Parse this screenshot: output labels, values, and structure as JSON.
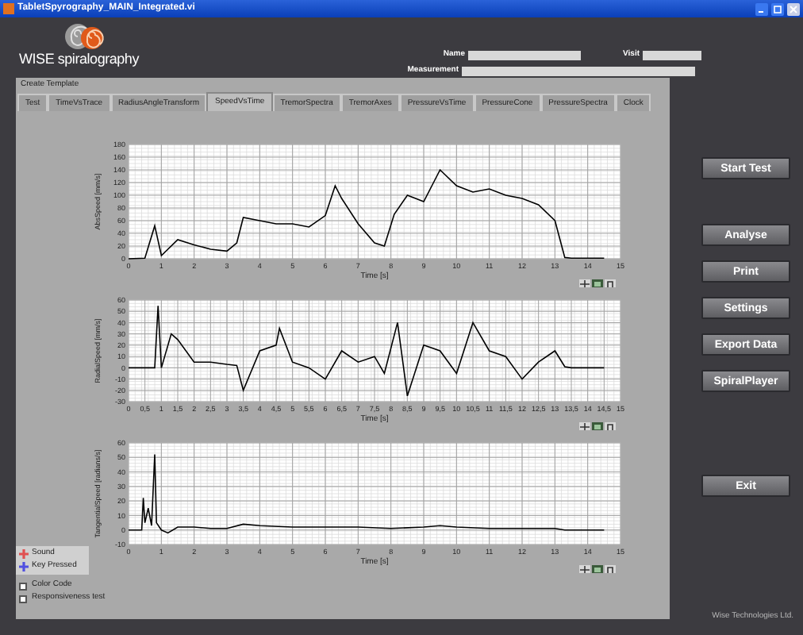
{
  "window": {
    "title": "TabletSpyrography_MAIN_Integrated.vi"
  },
  "logo_text": "WISE spiralography",
  "fields": [
    {
      "label": "Name"
    },
    {
      "label": "Visit"
    },
    {
      "label": "Measurement"
    }
  ],
  "template_label": "Create Template",
  "tabs": [
    {
      "label": "Test",
      "selected": false
    },
    {
      "label": "TimeVsTrace",
      "selected": false
    },
    {
      "label": "RadiusAngleTransform",
      "selected": false
    },
    {
      "label": "SpeedVsTime",
      "selected": true
    },
    {
      "label": "TremorSpectra",
      "selected": false
    },
    {
      "label": "TremorAxes",
      "selected": false
    },
    {
      "label": "PressureVsTime",
      "selected": false
    },
    {
      "label": "PressureCone",
      "selected": false
    },
    {
      "label": "PressureSpectra",
      "selected": false
    },
    {
      "label": "Clock",
      "selected": false
    }
  ],
  "charts": [
    {
      "chart_data": {
        "type": "line",
        "xlabel": "Time [s]",
        "ylabel": "AbsSpeed [mm/s]",
        "xlim": [
          0,
          15
        ],
        "ylim": [
          0,
          180
        ],
        "x": [
          0,
          0.5,
          0.8,
          1,
          1.5,
          2,
          2.5,
          3,
          3.3,
          3.5,
          4,
          4.5,
          5,
          5.5,
          6,
          6.3,
          6.5,
          7,
          7.5,
          7.8,
          8.1,
          8.5,
          9,
          9.5,
          10,
          10.5,
          11,
          11.5,
          12,
          12.5,
          13,
          13.3,
          13.5,
          14,
          14.5
        ],
        "values": [
          0,
          1,
          52,
          5,
          30,
          22,
          15,
          12,
          25,
          65,
          60,
          55,
          55,
          50,
          68,
          115,
          95,
          55,
          25,
          20,
          70,
          100,
          90,
          140,
          115,
          105,
          110,
          100,
          95,
          85,
          60,
          2,
          1,
          1,
          1
        ],
        "grid": true,
        "xticks": [
          0,
          1,
          2,
          3,
          4,
          5,
          6,
          7,
          8,
          9,
          10,
          11,
          12,
          13,
          14,
          15
        ],
        "yticks": [
          0,
          20,
          40,
          60,
          80,
          100,
          120,
          140,
          160,
          180
        ]
      }
    },
    {
      "chart_data": {
        "type": "line",
        "xlabel": "Time [s]",
        "ylabel": "RadialSpeed [mm/s]",
        "xlim": [
          0,
          15
        ],
        "ylim": [
          -30,
          60
        ],
        "x": [
          0,
          0.5,
          0.8,
          0.9,
          1,
          1.3,
          1.5,
          2,
          2.5,
          3,
          3.3,
          3.5,
          4,
          4.5,
          4.6,
          5,
          5.5,
          6,
          6.5,
          7,
          7.5,
          7.8,
          8.2,
          8.5,
          9,
          9.5,
          10,
          10.5,
          11,
          11.5,
          12,
          12.5,
          13,
          13.3,
          13.5,
          14,
          14.5
        ],
        "values": [
          0,
          0,
          0,
          55,
          0,
          30,
          25,
          5,
          5,
          3,
          2,
          -20,
          15,
          20,
          35,
          5,
          0,
          -10,
          15,
          5,
          10,
          -5,
          40,
          -25,
          20,
          15,
          -5,
          40,
          15,
          10,
          -10,
          5,
          15,
          1,
          0,
          0,
          0
        ],
        "grid": true,
        "xticks": [
          0,
          {
            "value": 0.5,
            "label": "0,5"
          },
          1,
          {
            "value": 1.5,
            "label": "1,5"
          },
          2,
          {
            "value": 2.5,
            "label": "2,5"
          },
          3,
          {
            "value": 3.5,
            "label": "3,5"
          },
          4,
          {
            "value": 4.5,
            "label": "4,5"
          },
          5,
          {
            "value": 5.5,
            "label": "5,5"
          },
          6,
          {
            "value": 6.5,
            "label": "6,5"
          },
          7,
          {
            "value": 7.5,
            "label": "7,5"
          },
          8,
          {
            "value": 8.5,
            "label": "8,5"
          },
          9,
          {
            "value": 9.5,
            "label": "9,5"
          },
          10,
          {
            "value": 10.5,
            "label": "10,5"
          },
          11,
          {
            "value": 11.5,
            "label": "11,5"
          },
          12,
          {
            "value": 12.5,
            "label": "12,5"
          },
          13,
          {
            "value": 13.5,
            "label": "13,5"
          },
          14,
          {
            "value": 14.5,
            "label": "14,5"
          },
          15
        ],
        "yticks": [
          -30,
          -20,
          -10,
          0,
          10,
          20,
          30,
          40,
          50,
          60
        ]
      }
    },
    {
      "chart_data": {
        "type": "line",
        "xlabel": "Time [s]",
        "ylabel": "TangentialSpeed [radians/s]",
        "xlim": [
          0,
          15
        ],
        "ylim": [
          -10,
          60
        ],
        "x": [
          0,
          0.4,
          0.45,
          0.5,
          0.6,
          0.7,
          0.8,
          0.85,
          1,
          1.2,
          1.5,
          2,
          2.5,
          3,
          3.5,
          4,
          5,
          6,
          7,
          8,
          9,
          9.5,
          10,
          11,
          12,
          13,
          13.3,
          14,
          14.5
        ],
        "values": [
          0,
          0,
          22,
          5,
          15,
          3,
          52,
          5,
          0,
          -2,
          2,
          2,
          1,
          1,
          4,
          3,
          2,
          2,
          2,
          1,
          2,
          3,
          2,
          1,
          1,
          1,
          0,
          0,
          0
        ],
        "grid": true,
        "xticks": [
          0,
          1,
          2,
          3,
          4,
          5,
          6,
          7,
          8,
          9,
          10,
          11,
          12,
          13,
          14,
          15
        ],
        "yticks": [
          -10,
          0,
          10,
          20,
          30,
          40,
          50,
          60
        ]
      }
    }
  ],
  "legend": [
    {
      "label": "Sound",
      "color": "#e05050"
    },
    {
      "label": "Key Pressed",
      "color": "#5050e0"
    }
  ],
  "checkboxes": [
    {
      "label": "Color Code",
      "checked": false
    },
    {
      "label": "Responsiveness test",
      "checked": false
    }
  ],
  "start_button": "Start Test",
  "action_buttons": [
    "Analyse",
    "Print",
    "Settings",
    "Export Data",
    "SpiralPlayer"
  ],
  "exit_button": "Exit",
  "footer": "Wise Technologies Ltd."
}
